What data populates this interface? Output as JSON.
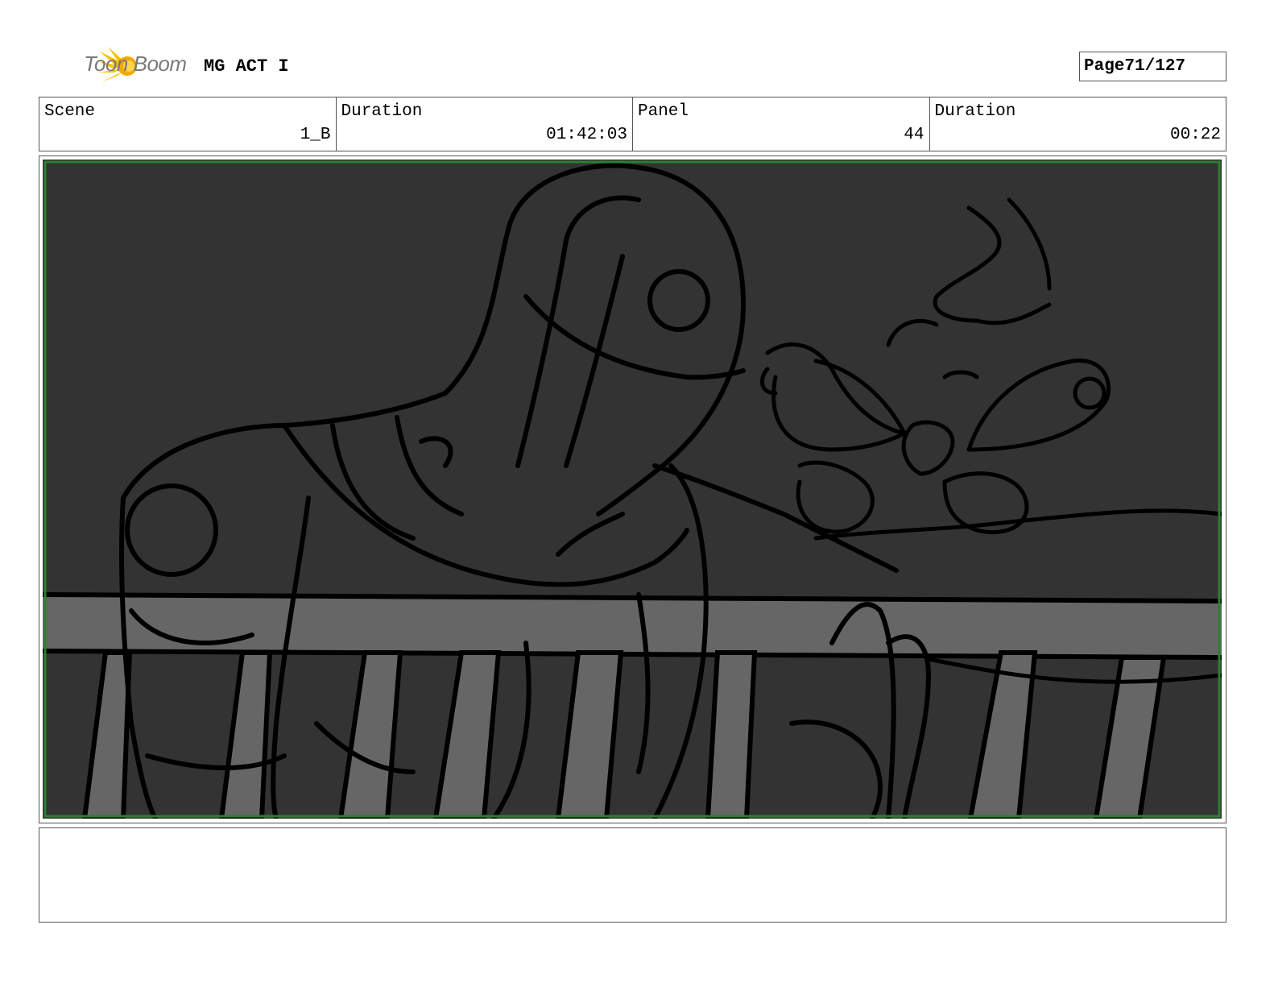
{
  "header": {
    "logo_text": "Toon Boom",
    "project_title": "MG ACT I",
    "page_label": "Page",
    "page_number": "71/127"
  },
  "info": [
    {
      "label": "Scene",
      "value": "1_B"
    },
    {
      "label": "Duration",
      "value": "01:42:03"
    },
    {
      "label": "Panel",
      "value": "44"
    },
    {
      "label": "Duration",
      "value": "00:22"
    }
  ],
  "panel": {
    "background_color": "#333333",
    "railing_color": "#666666",
    "frame_color": "#2e7d32",
    "line_color": "#000000"
  },
  "notes": {
    "text": ""
  }
}
